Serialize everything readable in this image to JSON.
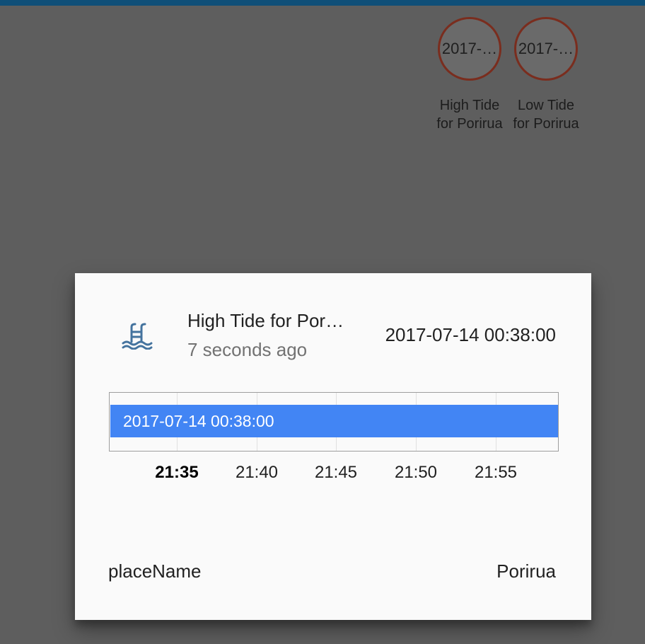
{
  "colors": {
    "topbar": "#0f4f78",
    "backdrop": "#5e5e5e",
    "badge_border": "#7a2d1e",
    "timeline_bar": "#4285f4",
    "icon": "#44739e"
  },
  "badges": [
    {
      "value": "2017-07-14 00:38:00",
      "value_display": "2017-…",
      "label_line1": "High Tide",
      "label_line2": "for Porirua"
    },
    {
      "value": "2017-…",
      "value_display": "2017-…",
      "label_line1": "Low Tide",
      "label_line2": "for Porirua"
    }
  ],
  "dialog": {
    "icon": "pool-icon",
    "entity_name": "High Tide for Porirua",
    "entity_name_display": "High Tide for Por…",
    "last_changed": "7 seconds ago",
    "state": "2017-07-14 00:38:00",
    "timeline": {
      "bar_label": "2017-07-14 00:38:00",
      "ticks": [
        "21:35",
        "21:40",
        "21:45",
        "21:50",
        "21:55"
      ],
      "bold_tick": "21:35"
    },
    "attributes": [
      {
        "name": "placeName",
        "value": "Porirua"
      }
    ]
  }
}
